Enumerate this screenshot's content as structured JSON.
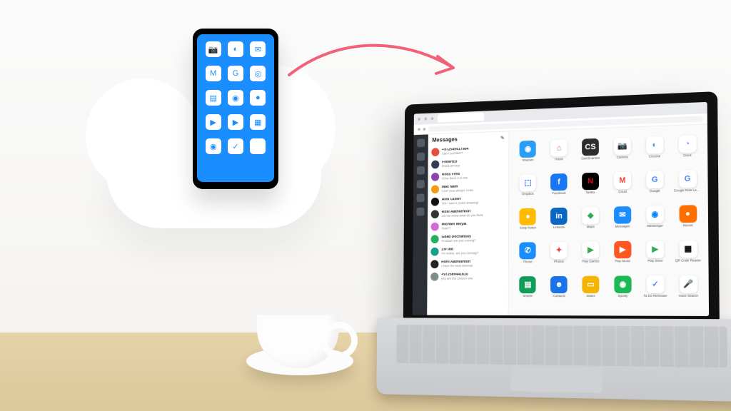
{
  "browser": {
    "url": "https://virtoo.anemone.com/main"
  },
  "panel": {
    "title": "Messages"
  },
  "messages": [
    {
      "name": "+972549417904",
      "preview": "Can I call later?",
      "color": "#e74c3c"
    },
    {
      "name": "Federico",
      "preview": "Kinda annoyz",
      "color": "#2c3e50"
    },
    {
      "name": "Ross Fred",
      "preview": "I'll be there in 5 min",
      "color": "#8e44ad"
    },
    {
      "name": "Max Nam",
      "preview": "Love your design, looks",
      "color": "#f39c12"
    },
    {
      "name": "Avik Guller",
      "preview": "Yes I saw it, looks amazing!",
      "color": "#111"
    },
    {
      "name": "Rosi Aathkemon",
      "preview": "Let me know what do you think",
      "color": "#333"
    },
    {
      "name": "Michael Moyal",
      "preview": "How??",
      "color": "#d46ad4"
    },
    {
      "name": "Gilad Dechansky",
      "preview": "Hi dude! are you coming?",
      "color": "#27ae60"
    },
    {
      "name": "Ziv Idd",
      "preview": "I'm online, are you coming?",
      "color": "#16a085"
    },
    {
      "name": "Roni Aathkemon",
      "preview": "I have the best internet!",
      "color": "#222"
    },
    {
      "name": "+972589441810",
      "preview": "you are the chosen one",
      "color": "#7f8c8d"
    }
  ],
  "apps": [
    {
      "label": "Shazam",
      "bg": "#2a9df4",
      "g": "◉"
    },
    {
      "label": "Home",
      "bg": "#ffffff",
      "fg": "#ea4335",
      "g": "⌂"
    },
    {
      "label": "CamScanner",
      "bg": "#2e2e2e",
      "g": "CS"
    },
    {
      "label": "Camera",
      "bg": "#ffffff",
      "fg": "#333",
      "g": "📷"
    },
    {
      "label": "Chrome",
      "bg": "#ffffff",
      "fg": "#4285f4",
      "g": "◐"
    },
    {
      "label": "Clock",
      "bg": "#ffffff",
      "fg": "#4285f4",
      "g": "◔"
    },
    {
      "label": "Dropbox",
      "bg": "#ffffff",
      "fg": "#0061ff",
      "g": "⬚"
    },
    {
      "label": "Facebook",
      "bg": "#1877f2",
      "g": "f"
    },
    {
      "label": "Netflix",
      "bg": "#000",
      "fg": "#e50914",
      "g": "N"
    },
    {
      "label": "Gmail",
      "bg": "#ffffff",
      "fg": "#ea4335",
      "g": "M"
    },
    {
      "label": "Google",
      "bg": "#ffffff",
      "fg": "#4285f4",
      "g": "G"
    },
    {
      "label": "Google Now Launcher",
      "bg": "#ffffff",
      "fg": "#4285f4",
      "g": "G"
    },
    {
      "label": "Keep Notes",
      "bg": "#ffbb00",
      "g": "●"
    },
    {
      "label": "LinkedIn",
      "bg": "#0a66c2",
      "g": "in"
    },
    {
      "label": "Maps",
      "bg": "#ffffff",
      "fg": "#34a853",
      "g": "◆"
    },
    {
      "label": "Messages",
      "bg": "#1a8dff",
      "g": "✉"
    },
    {
      "label": "Messenger",
      "bg": "#ffffff",
      "fg": "#0084ff",
      "g": "◉"
    },
    {
      "label": "Moovit",
      "bg": "#ff6f00",
      "g": "●"
    },
    {
      "label": "Phone",
      "bg": "#1a8dff",
      "g": "✆"
    },
    {
      "label": "Photos",
      "bg": "#ffffff",
      "fg": "#ea4335",
      "g": "✦"
    },
    {
      "label": "Play Games",
      "bg": "#ffffff",
      "fg": "#34a853",
      "g": "▶"
    },
    {
      "label": "Play Music",
      "bg": "#ff5722",
      "g": "▶"
    },
    {
      "label": "Play Store",
      "bg": "#ffffff",
      "fg": "#34a853",
      "g": "▶"
    },
    {
      "label": "QR Code Reader",
      "bg": "#ffffff",
      "fg": "#000",
      "g": "▦"
    },
    {
      "label": "Sheets",
      "bg": "#0f9d58",
      "g": "▤"
    },
    {
      "label": "Contacts",
      "bg": "#1a73e8",
      "g": "☻"
    },
    {
      "label": "Slides",
      "bg": "#f4b400",
      "g": "▭"
    },
    {
      "label": "Spotify",
      "bg": "#1db954",
      "g": "◉"
    },
    {
      "label": "To Do Reminder",
      "bg": "#ffffff",
      "fg": "#4285f4",
      "g": "✓"
    },
    {
      "label": "Voice Search",
      "bg": "#ffffff",
      "fg": "#ea4335",
      "g": "🎤"
    }
  ],
  "phone_icons": [
    {
      "g": "📷"
    },
    {
      "g": "◐"
    },
    {
      "g": "✉"
    },
    {
      "g": "M"
    },
    {
      "g": "G"
    },
    {
      "g": "◎"
    },
    {
      "g": "▤"
    },
    {
      "g": "◉"
    },
    {
      "g": "●"
    },
    {
      "g": "▶"
    },
    {
      "g": "▶"
    },
    {
      "g": "▦"
    },
    {
      "g": "◉"
    },
    {
      "g": "✓"
    },
    {
      "g": ""
    }
  ]
}
